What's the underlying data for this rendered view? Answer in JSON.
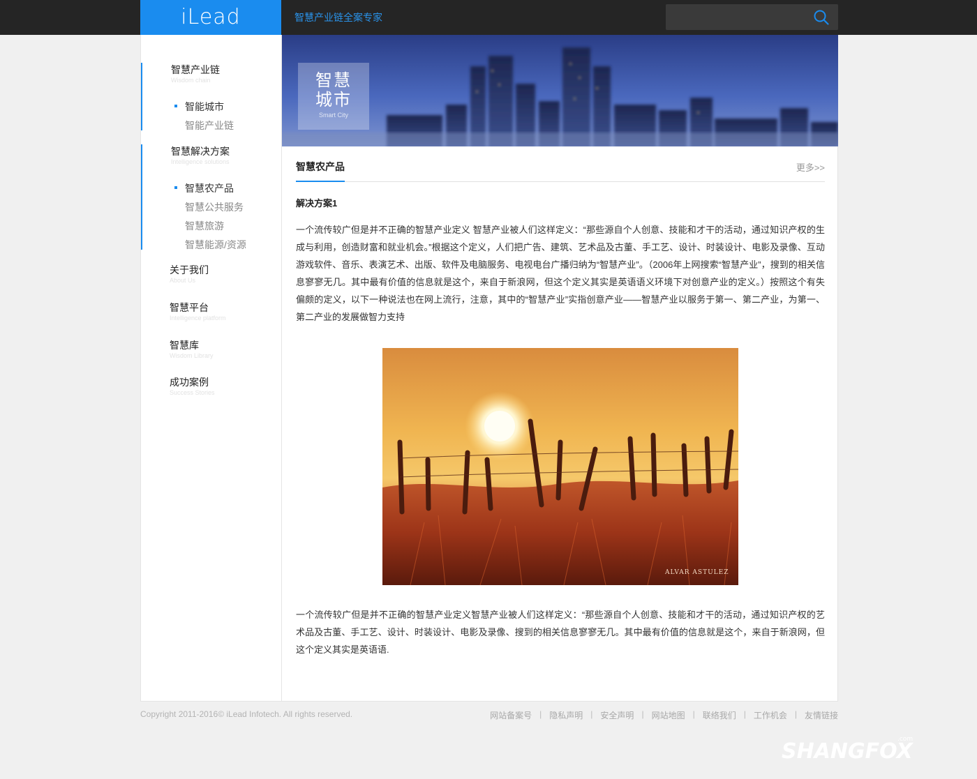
{
  "header": {
    "logo": "iLead",
    "slogan": "智慧产业链全案专家",
    "search": {
      "placeholder": "",
      "icon": "search-icon"
    }
  },
  "sidebar": {
    "sections": [
      {
        "title": "智慧产业链",
        "subtitle": "Wisdom chain",
        "active": true,
        "items": [
          {
            "label": "智能城市",
            "current": true
          },
          {
            "label": "智能产业链",
            "current": false
          }
        ]
      },
      {
        "title": "智慧解决方案",
        "subtitle": "Intelligence solutions",
        "active": true,
        "items": [
          {
            "label": "智慧农产品",
            "current": true
          },
          {
            "label": "智慧公共服务",
            "current": false
          },
          {
            "label": "智慧旅游",
            "current": false
          },
          {
            "label": "智慧能源/资源",
            "current": false
          }
        ]
      },
      {
        "title": "关于我们",
        "subtitle": "About Us"
      },
      {
        "title": "智慧平台",
        "subtitle": "Intelligence platform"
      },
      {
        "title": "智慧库",
        "subtitle": "Wisdom Library"
      },
      {
        "title": "成功案例",
        "subtitle": "Success Stories"
      }
    ]
  },
  "banner": {
    "line1": "智慧",
    "line2": "城市",
    "sub": "Smart City"
  },
  "content": {
    "section_title": "智慧农产品",
    "more_label": "更多>>",
    "article_title": "解决方案1",
    "paragraph1": "一个流传较广但是并不正确的智慧产业定义 智慧产业被人们这样定义：“那些源自个人创意、技能和才干的活动，通过知识产权的生成与利用，创造财富和就业机会。”根据这个定义，人们把广告、建筑、艺术品及古董、手工艺、设计、时装设计、电影及录像、互动游戏软件、音乐、表演艺术、出版、软件及电脑服务、电视电台广播归纳为“智慧产业”。（2006年上网搜索“智慧产业”，搜到的相关信息寥寥无几。其中最有价值的信息就是这个，来自于新浪网，但这个定义其实是英语语义环境下对创意产业的定义。）按照这个有失偏颇的定义，以下一种说法也在网上流行，注意，其中的“智慧产业”实指创意产业——智慧产业以服务于第一、第二产业，为第一、第二产业的发展做智力支持",
    "image_signature": "ALVAR ASTULEZ",
    "paragraph2": "一个流传较广但是并不正确的智慧产业定义智慧产业被人们这样定义：“那些源自个人创意、技能和才干的活动，通过知识产权的艺术品及古董、手工艺、设计、时装设计、电影及录像、搜到的相关信息寥寥无几。其中最有价值的信息就是这个，来自于新浪网，但这个定义其实是英语语."
  },
  "footer": {
    "copyright": "Copyright 2011-2016© iLead Infotech. All rights reserved.",
    "links": [
      "网站备案号",
      "隐私声明",
      "安全声明",
      "网站地图",
      "联络我们",
      "工作机会",
      "友情链接"
    ],
    "separator": "|"
  },
  "watermark": {
    "text": "SHANGFOX",
    "dotcom": ".com"
  },
  "colors": {
    "accent": "#1a8cef",
    "topbar": "#252525"
  }
}
